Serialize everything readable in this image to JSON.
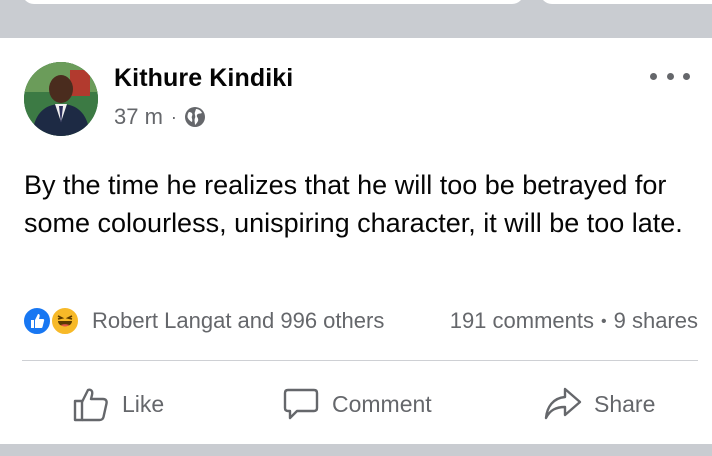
{
  "post": {
    "author": "Kithure Kindiki",
    "time": "37 m",
    "time_separator": "·",
    "audience_icon": "globe-icon",
    "text": "By the time he realizes that he will too be betrayed for some colourless, unispiring character, it will be too late."
  },
  "engagement": {
    "reaction_icons": [
      "like-reaction-icon",
      "haha-reaction-icon"
    ],
    "reactors": "Robert Langat and 996 others",
    "comments": "191 comments",
    "separator": "•",
    "shares": "9 shares"
  },
  "actions": {
    "like_label": "Like",
    "comment_label": "Comment",
    "share_label": "Share"
  },
  "colors": {
    "like_blue": "#1877f2",
    "haha_yellow": "#f7b928",
    "secondary_text": "#65676b",
    "feed_background": "#c9ccd1"
  }
}
